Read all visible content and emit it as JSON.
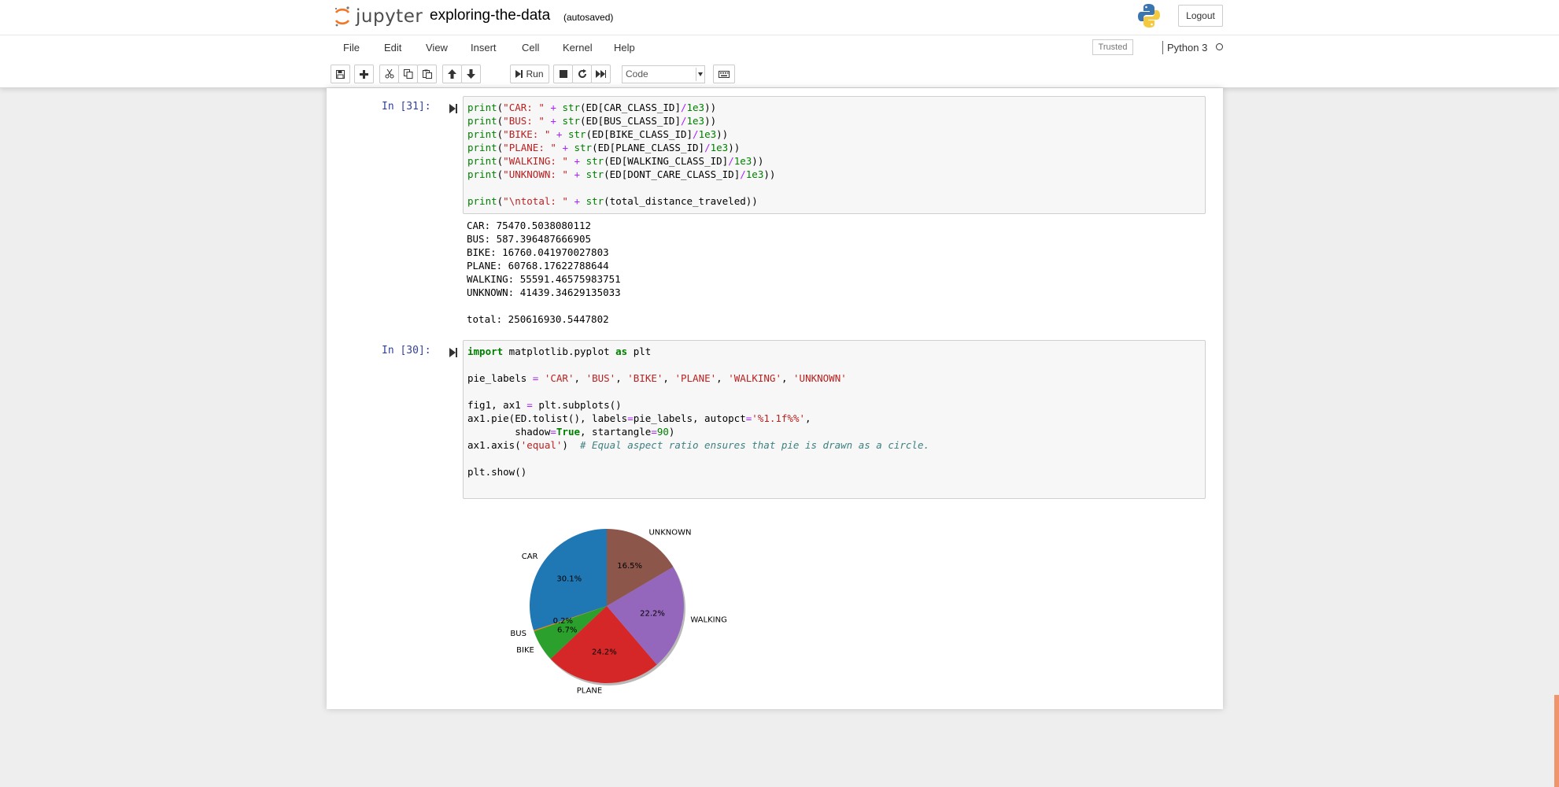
{
  "header": {
    "logo_text": "jupyter",
    "notebook_name": "exploring-the-data",
    "save_status": "(autosaved)",
    "logout_label": "Logout"
  },
  "menubar": {
    "items": [
      "File",
      "Edit",
      "View",
      "Insert",
      "Cell",
      "Kernel",
      "Help"
    ],
    "trusted_label": "Trusted",
    "kernel_name": "Python 3"
  },
  "toolbar": {
    "run_label": "Run",
    "cell_type": "Code",
    "icons": [
      "save-icon",
      "plus-icon",
      "cut-icon",
      "copy-icon",
      "paste-icon",
      "arrow-up-icon",
      "arrow-down-icon",
      "run-icon",
      "stop-icon",
      "restart-icon",
      "fast-forward-icon",
      "keyboard-icon"
    ]
  },
  "cells": [
    {
      "prompt": "In [31]:",
      "code": [
        "print(\"CAR: \" + str(ED[CAR_CLASS_ID]/1e3))",
        "print(\"BUS: \" + str(ED[BUS_CLASS_ID]/1e3))",
        "print(\"BIKE: \" + str(ED[BIKE_CLASS_ID]/1e3))",
        "print(\"PLANE: \" + str(ED[PLANE_CLASS_ID]/1e3))",
        "print(\"WALKING: \" + str(ED[WALKING_CLASS_ID]/1e3))",
        "print(\"UNKNOWN: \" + str(ED[DONT_CARE_CLASS_ID]/1e3))",
        "",
        "print(\"\\ntotal: \" + str(total_distance_traveled))"
      ],
      "output": [
        "CAR: 75470.5038080112",
        "BUS: 587.396487666905",
        "BIKE: 16760.041970027803",
        "PLANE: 60768.17622788644",
        "WALKING: 55591.46575983751",
        "UNKNOWN: 41439.34629135033",
        "",
        "total: 250616930.5447802"
      ]
    },
    {
      "prompt": "In [30]:",
      "code": [
        "import matplotlib.pyplot as plt",
        "",
        "pie_labels = 'CAR', 'BUS', 'BIKE', 'PLANE', 'WALKING', 'UNKNOWN'",
        "",
        "fig1, ax1 = plt.subplots()",
        "ax1.pie(ED.tolist(), labels=pie_labels, autopct='%1.1f%%',",
        "        shadow=True, startangle=90)",
        "ax1.axis('equal')  # Equal aspect ratio ensures that pie is drawn as a circle.",
        "",
        "plt.show()"
      ]
    }
  ],
  "chart_data": {
    "type": "pie",
    "categories": [
      "CAR",
      "BUS",
      "BIKE",
      "PLANE",
      "WALKING",
      "UNKNOWN"
    ],
    "values": [
      30.1,
      0.2,
      6.7,
      24.2,
      22.2,
      16.5
    ],
    "value_labels": [
      "30.1%",
      "0.2%",
      "6.7%",
      "24.2%",
      "22.2%",
      "16.5%"
    ],
    "colors": [
      "#1f77b4",
      "#ff7f0e",
      "#2ca02c",
      "#d62728",
      "#9467bd",
      "#8c564b"
    ],
    "start_angle": 90,
    "shadow": true
  }
}
